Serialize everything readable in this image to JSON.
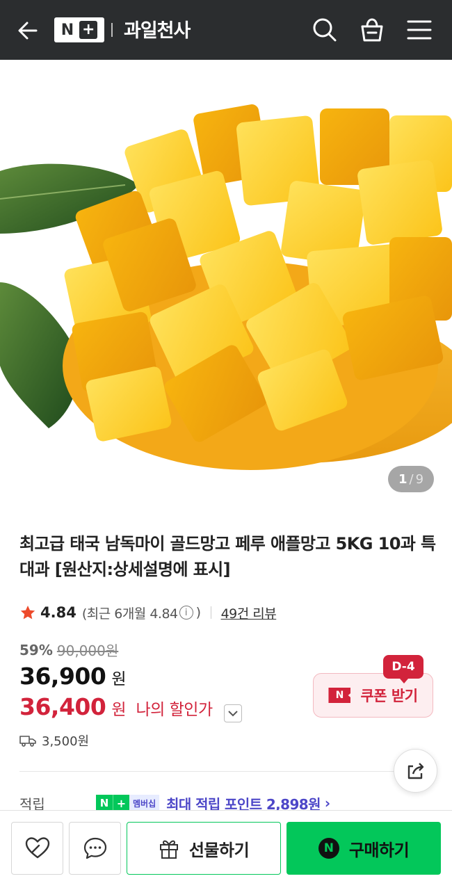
{
  "header": {
    "logo_n": "N",
    "logo_plus": "+",
    "store_name": "과일천사",
    "icons": [
      "back-arrow-icon",
      "search-icon",
      "shopping-bag-icon",
      "menu-icon"
    ],
    "background_color": "#2b2d2f"
  },
  "gallery": {
    "current": "1",
    "separator": "/",
    "total": "9"
  },
  "product": {
    "title": "최고급 태국 남독마이 골드망고 페루 애플망고 5KG 10과 특대과 [원산지:상세설명에 표시]",
    "rating": {
      "score": "4.84",
      "recent": "(최근 6개월 4.84",
      "info_symbol": "i",
      "recent_close": ")",
      "reviews_link": "49건 리뷰"
    },
    "discount_rate": "59%",
    "original_price": "90,000원",
    "price": "36,900",
    "price_unit": "원",
    "my_price": "36,400",
    "my_price_unit": "원",
    "my_price_label": "나의 할인가"
  },
  "coupon": {
    "icon_letter": "N",
    "label": "쿠폰 받기",
    "dday": "D-4"
  },
  "shipping": {
    "fee": "3,500원"
  },
  "points": {
    "label": "적립",
    "badge_n": "N",
    "badge_plus": "+",
    "badge_member": "멤버십",
    "text": "최대 적립 포인트 2,898원",
    "chevron": "›"
  },
  "bottom_bar": {
    "gift_label": "선물하기",
    "buy_icon_letter": "N",
    "buy_label": "구매하기"
  },
  "colors": {
    "naver_green": "#03c75a",
    "sale_red": "#d2233b",
    "points_purple": "#4d47c8"
  }
}
